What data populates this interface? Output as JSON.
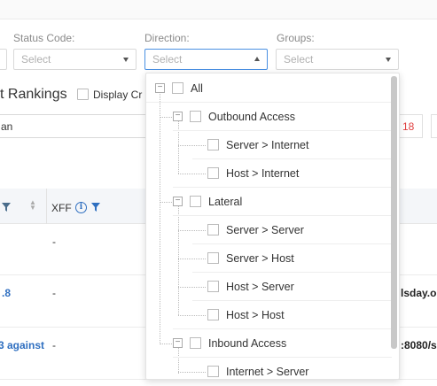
{
  "filters": {
    "status_code": {
      "label": "Status Code:",
      "placeholder": "Select"
    },
    "direction": {
      "label": "Direction:",
      "placeholder": "Select"
    },
    "groups": {
      "label": "Groups:",
      "placeholder": "Select"
    }
  },
  "rankings_title": "t Rankings",
  "display_checkbox_label": "Display Cr",
  "search_value": "an",
  "pagination": {
    "page": "18"
  },
  "table": {
    "xff_header": "XFF",
    "rows": [
      {
        "left": "",
        "xff": "-",
        "right": ""
      },
      {
        "left": ".8",
        "xff": "-",
        "right": "lsday.o"
      },
      {
        "left": "3 against",
        "xff": "-",
        "right": ":8080/s"
      }
    ]
  },
  "direction_tree": [
    {
      "label": "All",
      "level": 0,
      "toggle": "-"
    },
    {
      "label": "Outbound Access",
      "level": 1,
      "toggle": "-"
    },
    {
      "label": "Server > Internet",
      "level": 2
    },
    {
      "label": "Host > Internet",
      "level": 2
    },
    {
      "label": "Lateral",
      "level": 1,
      "toggle": "-"
    },
    {
      "label": "Server > Server",
      "level": 2
    },
    {
      "label": "Server > Host",
      "level": 2
    },
    {
      "label": "Host > Server",
      "level": 2
    },
    {
      "label": "Host > Host",
      "level": 2
    },
    {
      "label": "Inbound Access",
      "level": 1,
      "toggle": "-"
    },
    {
      "label": "Internet > Server",
      "level": 2
    }
  ],
  "colors": {
    "accent": "#4a90e2",
    "link": "#2f6fc0",
    "page_active": "#e04040"
  }
}
